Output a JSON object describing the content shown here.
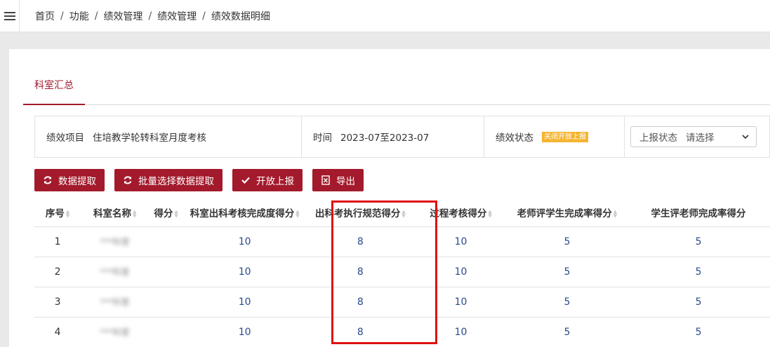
{
  "breadcrumb": [
    "首页",
    "功能",
    "绩效管理",
    "绩效管理",
    "绩效数据明细"
  ],
  "breadcrumb_sep": "/",
  "tabs": {
    "active": "科室汇总"
  },
  "filter": {
    "project_label": "绩效项目",
    "project_value": "住培教学轮转科室月度考核",
    "time_label": "时间",
    "time_value": "2023-07至2023-07",
    "status_label": "绩效状态",
    "status_badge": "关闭开放上报",
    "report_label": "上报状态",
    "report_value": "请选择"
  },
  "toolbar": {
    "extract": "数据提取",
    "batch_extract": "批量选择数据提取",
    "open_report": "开放上报",
    "export": "导出"
  },
  "table": {
    "columns": [
      "序号",
      "科室名称",
      "得分",
      "科室出科考核完成度得分",
      "出科考执行规范得分",
      "过程考核得分",
      "老师评学生完成率得分",
      "学生评老师完成率得分"
    ],
    "rows": [
      [
        "1",
        "***科室",
        "",
        "10",
        "8",
        "10",
        "5",
        "5"
      ],
      [
        "2",
        "***科室",
        "",
        "10",
        "8",
        "10",
        "5",
        "5"
      ],
      [
        "3",
        "***科室",
        "",
        "10",
        "8",
        "10",
        "5",
        "5"
      ],
      [
        "4",
        "***科室",
        "",
        "10",
        "8",
        "10",
        "5",
        "5"
      ]
    ]
  },
  "colors": {
    "accent": "#a31a2c",
    "value_text": "#2a4a8a",
    "badge": "#f5b431",
    "highlight": "#e01010"
  }
}
